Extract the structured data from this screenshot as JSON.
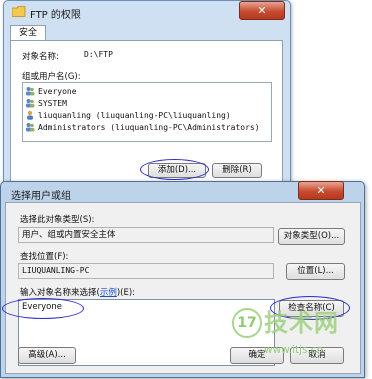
{
  "props_window": {
    "title": "FTP 的权限",
    "close_glyph": "✕",
    "tab_label": "安全",
    "object_name_label": "对象名称:",
    "object_name_value": "D:\\FTP",
    "group_label": "组或用户名(G):",
    "users": [
      {
        "name": "Everyone",
        "icon": "users-group-icon"
      },
      {
        "name": "SYSTEM",
        "icon": "users-group-icon"
      },
      {
        "name": "liuquanling (liuquanling-PC\\liuquanling)",
        "icon": "single-user-icon"
      },
      {
        "name": "Administrators (liuquanling-PC\\Administrators)",
        "icon": "users-group-icon"
      }
    ],
    "add_button": "添加(D)...",
    "remove_button": "删除(R)"
  },
  "select_dialog": {
    "title": "选择用户或组",
    "close_glyph": "✕",
    "object_type_label": "选择此对象类型(S):",
    "object_type_value": "用户、组或内置安全主体",
    "object_type_button": "对象类型(O)...",
    "location_label": "查找位置(F):",
    "location_value": "LIUQUANLING-PC",
    "location_button": "位置(L)...",
    "enter_names_label_prefix": "输入对象名称来选择(",
    "enter_names_label_link": "示例",
    "enter_names_label_suffix": ")(E):",
    "enter_names_value": "Everyone",
    "check_names_button": "检查名称(C)",
    "advanced_button": "高级(A)...",
    "ok_button": "确定",
    "cancel_button": "取消"
  },
  "watermark": {
    "number": "17",
    "chars": "技术网",
    "url": "www.itjs.cn"
  },
  "colors": {
    "annotation": "#2b2bd0",
    "link": "#1a4bd6",
    "close_red": "#c74b2f",
    "watermark_green": "#9bd07a"
  }
}
